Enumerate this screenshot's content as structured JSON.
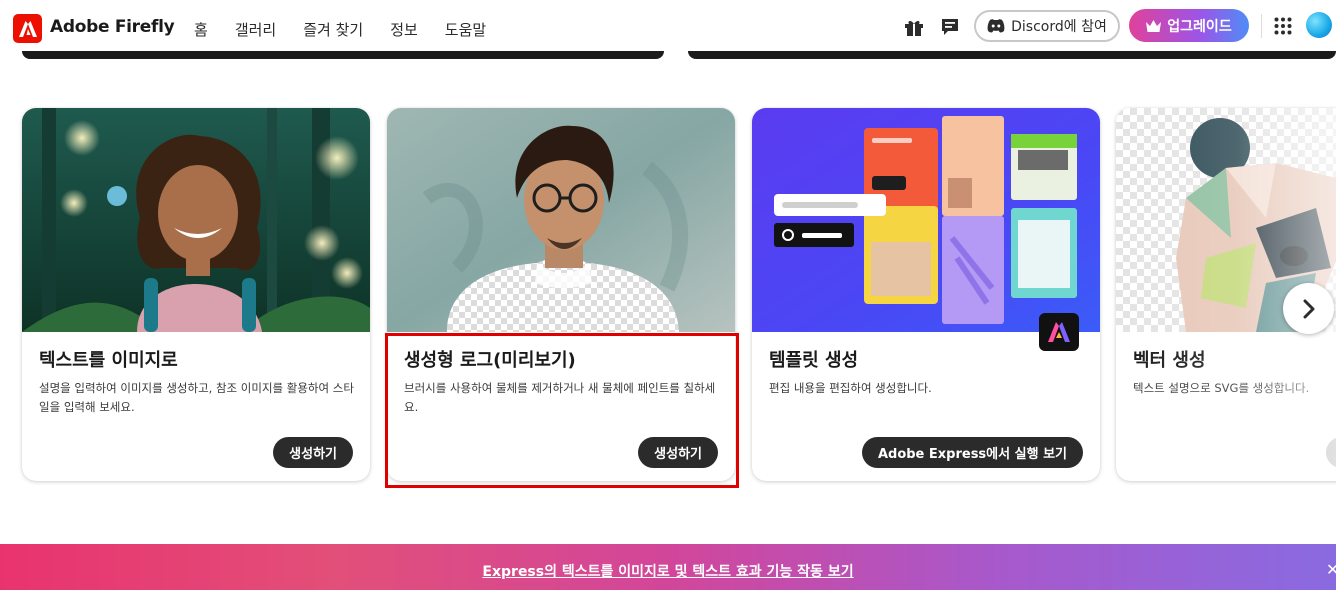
{
  "header": {
    "app_title": "Adobe Firefly",
    "nav": [
      {
        "label": "홈",
        "active": true
      },
      {
        "label": "갤러리",
        "active": false
      },
      {
        "label": "즐겨 찾기",
        "active": false
      },
      {
        "label": "정보",
        "active": false
      },
      {
        "label": "도움말",
        "active": false
      }
    ],
    "discord_label": "Discord에 참여",
    "upgrade_label": "업그레이드"
  },
  "cards": [
    {
      "title": "텍스트를 이미지로",
      "description": "설명을 입력하여 이미지를 생성하고, 참조 이미지를 활용하여 스타일을 입력해 보세요.",
      "button": "생성하기"
    },
    {
      "title": "생성형 로그(미리보기)",
      "description": "브러시를 사용하여 물체를 제거하거나 새 물체에 페인트를 칠하세요.",
      "button": "생성하기",
      "highlighted": true
    },
    {
      "title": "템플릿 생성",
      "description": "편집 내용을 편집하여 생성합니다.",
      "button": "Adobe Express에서 실행 보기"
    },
    {
      "title": "벡터 생성",
      "description": "텍스트 설명으로 SVG를 생성합니다."
    }
  ],
  "banner": {
    "link_text": "Express의 텍스트를 이미지로 및 텍스트 효과 기능 작동 보기",
    "close": "✕"
  },
  "colors": {
    "brand_red": "#eb1000",
    "highlight_red": "#e00000",
    "button_dark": "#2b2b2b"
  },
  "icons": [
    "adobe-logo-icon",
    "gift-icon",
    "chat-icon",
    "discord-icon",
    "crown-icon",
    "apps-grid-icon",
    "chevron-right-icon",
    "close-icon",
    "express-logo-icon"
  ]
}
